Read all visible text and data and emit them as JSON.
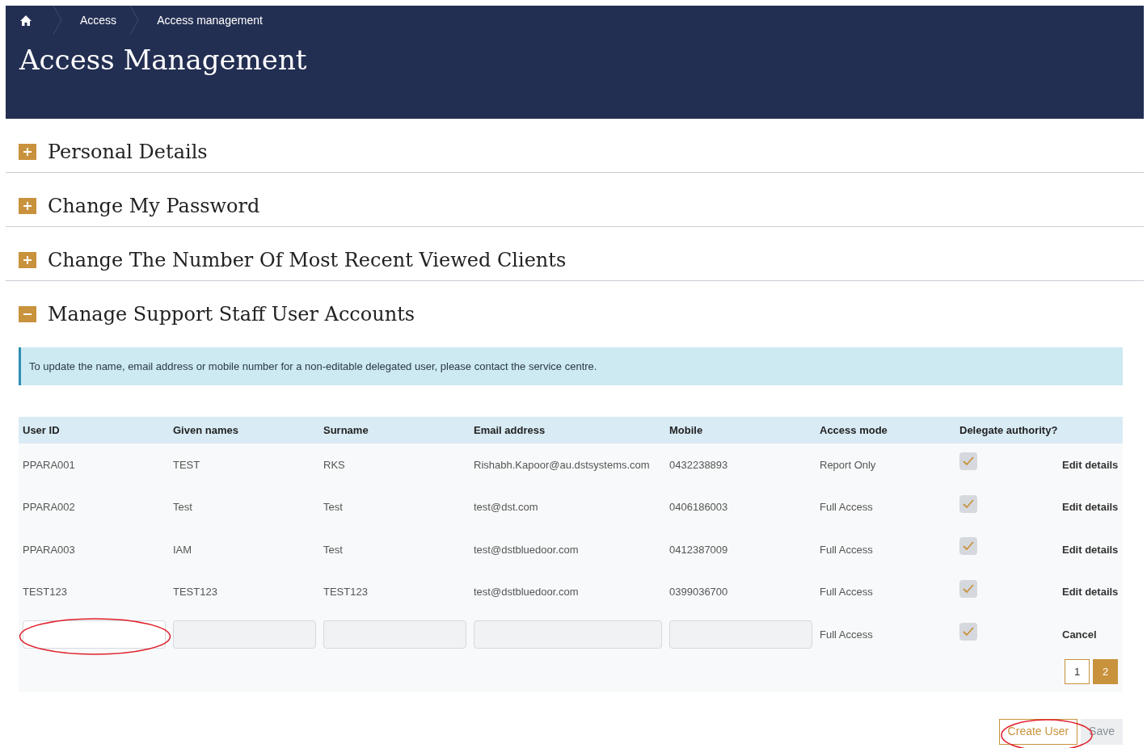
{
  "breadcrumbs": [
    {
      "kind": "home"
    },
    {
      "kind": "link",
      "label": "Access"
    },
    {
      "kind": "link",
      "label": "Access management"
    }
  ],
  "page_title": "Access Management",
  "sections": [
    {
      "title": "Personal Details",
      "expanded": false
    },
    {
      "title": "Change My Password",
      "expanded": false
    },
    {
      "title": "Change The Number Of Most Recent Viewed Clients",
      "expanded": false
    },
    {
      "title": "Manage Support Staff User Accounts",
      "expanded": true
    }
  ],
  "info_message": "To update the name, email address or mobile number for a non-editable delegated user, please contact the service centre.",
  "table": {
    "columns": [
      "User ID",
      "Given names",
      "Surname",
      "Email address",
      "Mobile",
      "Access mode",
      "Delegate authority?"
    ],
    "rows": [
      {
        "kind": "user",
        "cells": [
          "PPARA001",
          "TEST",
          "RKS",
          "Rishabh.Kapoor@au.dstsystems.com",
          "0432238893",
          "Report Only"
        ],
        "delegate": true,
        "action": "Edit details"
      },
      {
        "kind": "user",
        "cells": [
          "PPARA002",
          "Test",
          "Test",
          "test@dst.com",
          "0406186003",
          "Full Access"
        ],
        "delegate": true,
        "action": "Edit details"
      },
      {
        "kind": "user",
        "cells": [
          "PPARA003",
          "IAM",
          "Test",
          "test@dstbluedoor.com",
          "0412387009",
          "Full Access"
        ],
        "delegate": true,
        "action": "Edit details"
      },
      {
        "kind": "user",
        "cells": [
          "TEST123",
          "TEST123",
          "TEST123",
          "test@dstbluedoor.com",
          "0399036700",
          "Full Access"
        ],
        "delegate": true,
        "action": "Edit details"
      },
      {
        "kind": "new",
        "fields": [
          {
            "focused": true
          },
          {
            "focused": false
          },
          {
            "focused": false
          },
          {
            "focused": false
          },
          {
            "focused": false
          }
        ],
        "access_mode": "Full Access",
        "delegate": true,
        "action": "Cancel"
      }
    ]
  },
  "pagination": [
    {
      "label": "1",
      "selected": false
    },
    {
      "label": "2",
      "selected": true
    }
  ],
  "buttons": [
    {
      "label": "Create User",
      "disabled": false
    },
    {
      "label": "Save",
      "disabled": true
    }
  ]
}
